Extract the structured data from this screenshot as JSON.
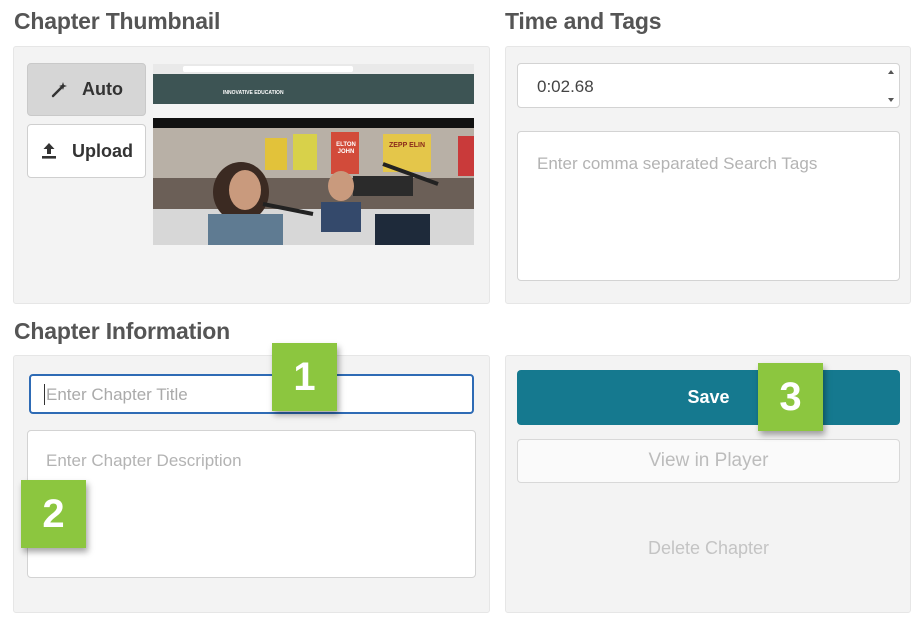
{
  "thumbnail_section": {
    "title": "Chapter Thumbnail",
    "auto_label": "Auto",
    "upload_label": "Upload",
    "auto_icon": "magic-wand-icon",
    "upload_icon": "upload-icon",
    "preview": {
      "site_name": "INNOVATIVE EDUCATION",
      "posters": [
        "ELTON JOHN",
        "ZEPP ELIN"
      ]
    }
  },
  "time_tags_section": {
    "title": "Time and Tags",
    "time_value": "0:02.68",
    "tags_placeholder": "Enter comma separated Search Tags"
  },
  "info_section": {
    "title": "Chapter Information",
    "title_placeholder": "Enter Chapter Title",
    "description_placeholder": "Enter Chapter Description"
  },
  "actions": {
    "save_label": "Save",
    "view_label": "View in Player",
    "delete_label": "Delete Chapter"
  },
  "callouts": [
    "1",
    "2",
    "3"
  ],
  "colors": {
    "accent": "#15798f",
    "callout": "#8cc63f",
    "focus_border": "#2e6bb5"
  }
}
